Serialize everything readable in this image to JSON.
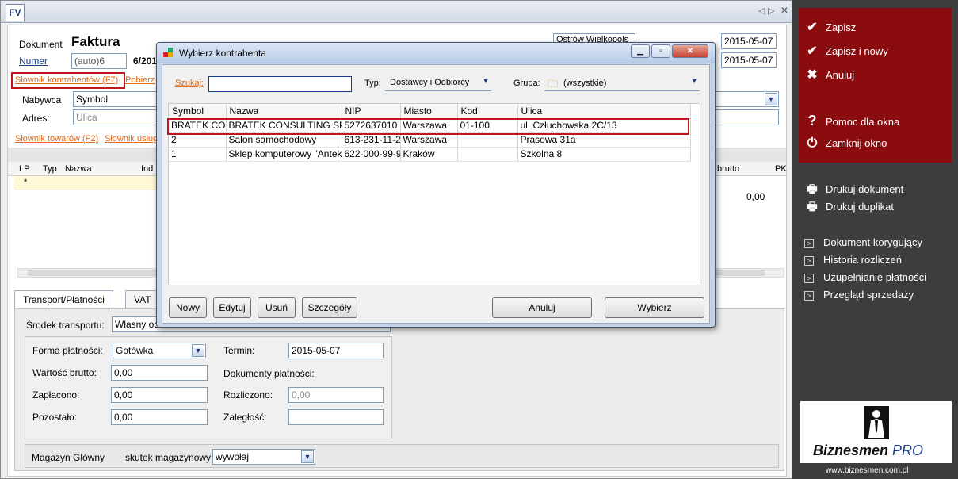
{
  "tab": {
    "label": "FV"
  },
  "doc": {
    "dokument_label": "Dokument",
    "title": "Faktura",
    "numer_link": "Numer",
    "numer_value": "(auto)6",
    "numer_suffix": "6/201",
    "city": "Ostrów Wielkopols",
    "date1": "2015-05-07",
    "date2": "2015-05-07",
    "slownik_kontrahentow": "Słownik kontrahentów (F7)",
    "pobierz": "Pobierz",
    "nabywca_label": "Nabywca",
    "nabywca_value": "Symbol",
    "adres_label": "Adres:",
    "adres_placeholder": "Ulica",
    "slownik_towarow": "Słownik towarów (F2)",
    "slownik_uslug": "Słownik usług",
    "grid_cols": [
      "LP",
      "Typ",
      "Nazwa",
      "Ind"
    ],
    "grid_right_cols": [
      "brutto",
      "PK"
    ],
    "grid_star": "*",
    "grid_total": "0,00"
  },
  "bottom": {
    "tab_transport": "Transport/Płatności",
    "tab_vat": "VAT",
    "srodek_label": "Środek transportu:",
    "srodek_value": "Własny od",
    "forma_label": "Forma płatności:",
    "forma_value": "Gotówka",
    "termin_label": "Termin:",
    "termin_value": "2015-05-07",
    "wartosc_label": "Wartość brutto:",
    "wartosc_value": "0,00",
    "dokumenty_label": "Dokumenty płatności:",
    "zaplacono_label": "Zapłacono:",
    "zaplacono_value": "0,00",
    "rozliczono_label": "Rozliczono:",
    "rozliczono_value": "0,00",
    "pozostalo_label": "Pozostało:",
    "pozostalo_value": "0,00",
    "zaleglosc_label": "Zaległość:",
    "magazyn_label": "Magazyn Główny",
    "skutek_label": "skutek magazynowy",
    "skutek_value": "wywołaj"
  },
  "dialog": {
    "title": "Wybierz kontrahenta",
    "szukaj_label": "Szukaj:",
    "szukaj_value": "",
    "typ_label": "Typ:",
    "typ_value": "Dostawcy i Odbiorcy",
    "grupa_label": "Grupa:",
    "grupa_value": "(wszystkie)",
    "columns": [
      "Symbol",
      "Nazwa",
      "NIP",
      "Miasto",
      "Kod",
      "Ulica"
    ],
    "rows": [
      [
        "BRATEK CO",
        "BRATEK CONSULTING SP",
        "5272637010",
        "Warszawa",
        "01-100",
        "ul. Człuchowska 2C/13"
      ],
      [
        "2",
        "Salon samochodowy",
        "613-231-11-2",
        "Warszawa",
        "",
        "Prasowa 31a"
      ],
      [
        "1",
        "Sklep komputerowy \"Antek\"",
        "622-000-99-9",
        "Kraków",
        "",
        "Szkolna 8"
      ]
    ],
    "btn_nowy": "Nowy",
    "btn_edytuj": "Edytuj",
    "btn_usun": "Usuń",
    "btn_szczegoly": "Szczegóły",
    "btn_anuluj": "Anuluj",
    "btn_wybierz": "Wybierz"
  },
  "side": {
    "zapisz": "Zapisz",
    "zapisz_i_nowy": "Zapisz i nowy",
    "anuluj": "Anuluj",
    "pomoc": "Pomoc dla okna",
    "zamknij": "Zamknij okno",
    "drukuj_dokument": "Drukuj dokument",
    "drukuj_duplikat": "Drukuj duplikat",
    "dokument_korygujacy": "Dokument korygujący",
    "historia": "Historia rozliczeń",
    "uzupelnianie": "Uzupełnianie płatności",
    "przeglad": "Przegląd sprzedaży"
  },
  "logo": {
    "brand": "Biznesmen",
    "brand_pro": "PRO",
    "url": "www.biznesmen.com.pl"
  },
  "colors": {
    "accent_red": "#8a0c0f",
    "link_orange": "#e06a1a",
    "highlight_red": "#c0161d"
  }
}
